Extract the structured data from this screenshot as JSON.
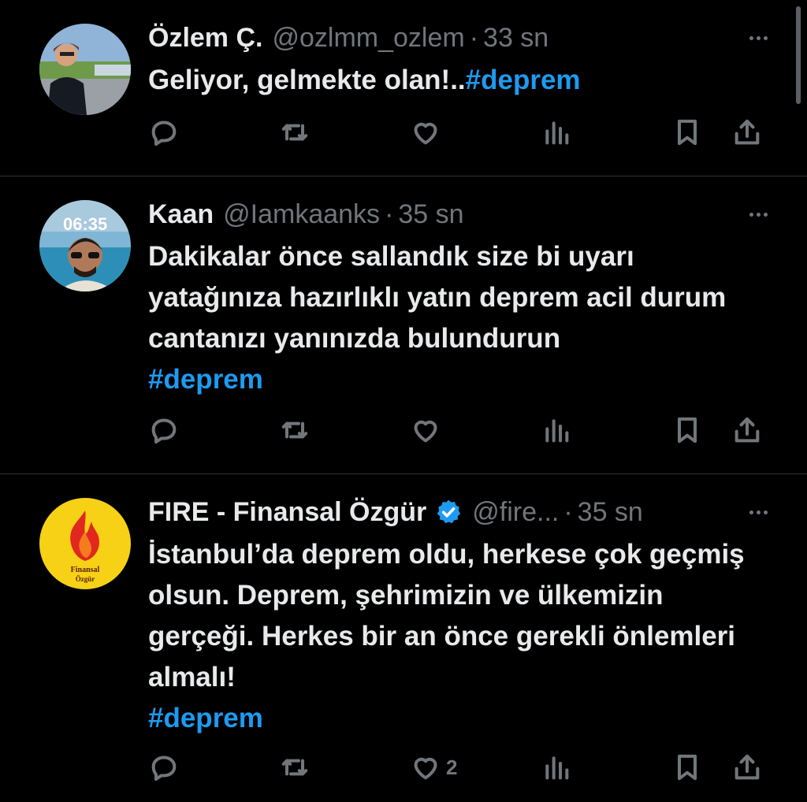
{
  "colors": {
    "background": "#000000",
    "text": "#e7e9ea",
    "muted": "#71767b",
    "hashtag": "#1d9bf0",
    "divider": "#2f3336",
    "verified": "#1d9bf0"
  },
  "tweets": [
    {
      "name": "Özlem Ç.",
      "handle": "@ozlmm_ozlem",
      "separator": "·",
      "time": "33 sn",
      "text": "Geliyor, gelmekte olan!..",
      "hashtag": "#deprem",
      "avatar": "woman-photo-avatar",
      "likes": ""
    },
    {
      "name": "Kaan",
      "handle": "@Iamkaanks",
      "separator": "·",
      "time": "35 sn",
      "text": "Dakikalar önce sallandık size bi uyarı yatağınıza hazırlıklı yatın deprem acil durum cantanızı yanınızda bulundurun",
      "hashtag": "#deprem",
      "avatar": "man-sunglasses-avatar",
      "avatar_text": "06:35",
      "likes": ""
    },
    {
      "name": "FIRE - Finansal Özgür",
      "handle": "@fire...",
      "separator": "·",
      "time": "35 sn",
      "text": "İstanbul’da deprem oldu, herkese çok geçmiş olsun. Deprem, şehrimizin ve ülkemizin gerçeği. Herkes bir an önce gerekli önlemleri almalı!",
      "hashtag": "#deprem",
      "avatar": "fire-logo-avatar",
      "avatar_text_line1": "Finansal",
      "avatar_text_line2": "Özgür",
      "verified": true,
      "likes": "2"
    }
  ],
  "icons": [
    "reply-icon",
    "retweet-icon",
    "like-icon",
    "views-icon",
    "bookmark-icon",
    "share-icon",
    "more-icon",
    "verified-icon"
  ]
}
